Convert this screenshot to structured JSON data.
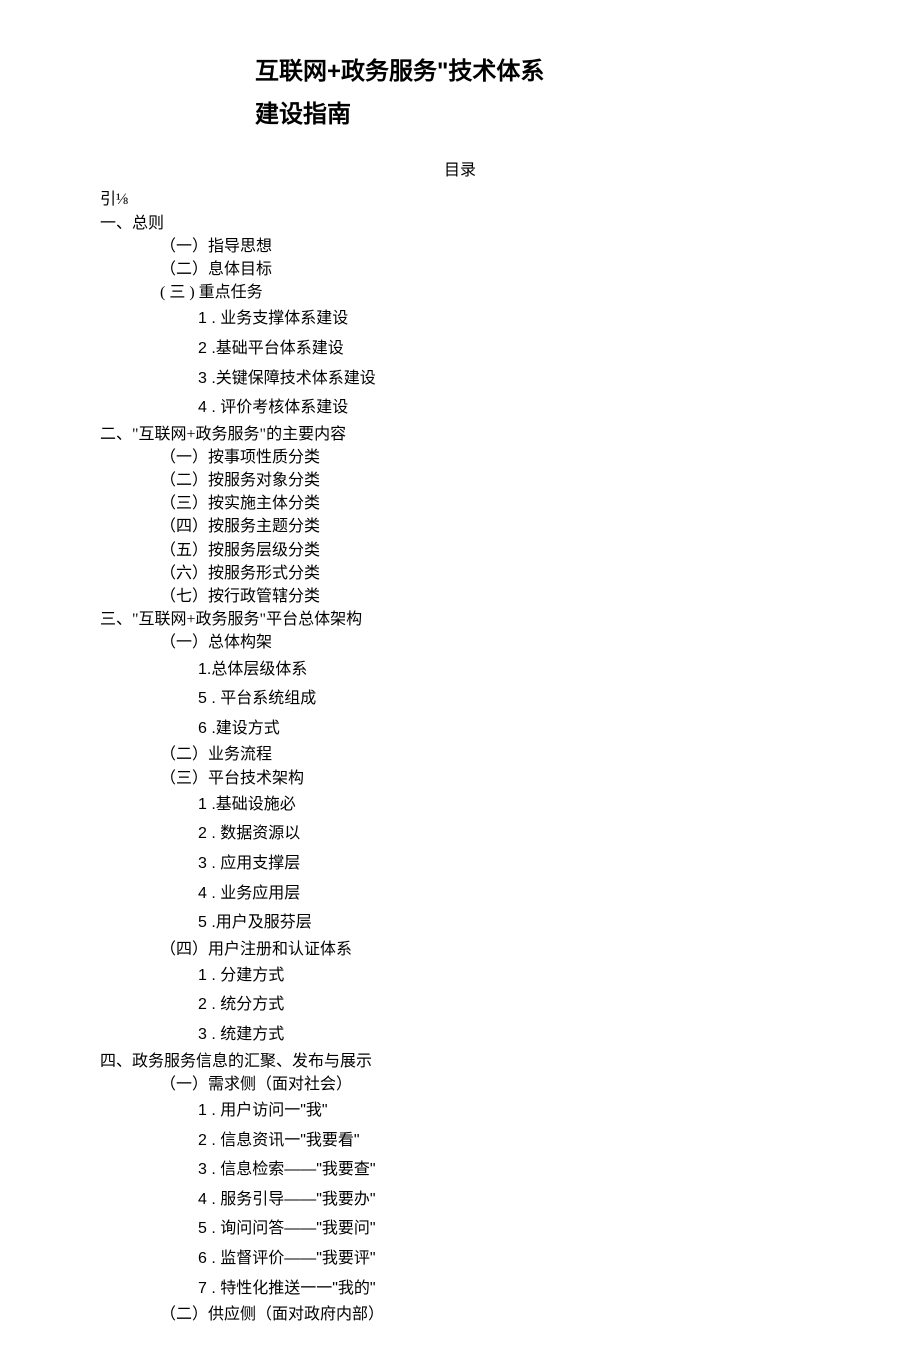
{
  "title": {
    "line1": "互联网+政务服务\"技术体系",
    "line2": "建设指南"
  },
  "toc_label": "目录",
  "toc": [
    {
      "lvl": 0,
      "text": "引⅛"
    },
    {
      "lvl": 1,
      "text": "一、总则"
    },
    {
      "lvl": 2,
      "text": "（一）指导思想"
    },
    {
      "lvl": 2,
      "text": "（二）息体目标"
    },
    {
      "lvl": 2,
      "text": "( 三 ) 重点任务"
    },
    {
      "lvl": 3,
      "num": "1",
      "text": " . 业务支撑体系建设"
    },
    {
      "lvl": 3,
      "num": "2",
      "text": " .基础平台体系建设"
    },
    {
      "lvl": 3,
      "num": "3",
      "text": " .关键保障技术体系建设"
    },
    {
      "lvl": 3,
      "num": "4",
      "text": " . 评价考核体系建设"
    },
    {
      "lvl": 1,
      "text": "二、\"互联网+政务服务\"的主要内容"
    },
    {
      "lvl": 2,
      "text": "（一）按事项性质分类"
    },
    {
      "lvl": 2,
      "text": "（二）按服务对象分类"
    },
    {
      "lvl": 2,
      "text": "（三）按实施主体分类"
    },
    {
      "lvl": 2,
      "text": "（四）按服务主题分类"
    },
    {
      "lvl": 2,
      "text": "（五）按服务层级分类"
    },
    {
      "lvl": 2,
      "text": "（六）按服务形式分类"
    },
    {
      "lvl": 2,
      "text": "（七）按行政管辖分类"
    },
    {
      "lvl": 1,
      "text": "三、\"互联网+政务服务\"平台总体架构"
    },
    {
      "lvl": 2,
      "text": "（一）总体构架"
    },
    {
      "lvl": 3,
      "num": "1.",
      "text": "总体层级体系"
    },
    {
      "lvl": 3,
      "num": "5",
      "text": " . 平台系统组成"
    },
    {
      "lvl": 3,
      "num": "6",
      "text": " .建设方式"
    },
    {
      "lvl": 2,
      "text": "（二）业务流程"
    },
    {
      "lvl": 2,
      "text": "（三）平台技术架构"
    },
    {
      "lvl": 3,
      "num": "1",
      "text": " .基础设施必"
    },
    {
      "lvl": 3,
      "num": "2",
      "text": " . 数据资源以"
    },
    {
      "lvl": 3,
      "num": "3",
      "text": " . 应用支撑层"
    },
    {
      "lvl": 3,
      "num": "4",
      "text": " . 业务应用层"
    },
    {
      "lvl": 3,
      "num": "5",
      "text": " .用户及服芬层"
    },
    {
      "lvl": 2,
      "text": "（四）用户注册和认证体系"
    },
    {
      "lvl": 3,
      "num": "1",
      "text": " . 分建方式"
    },
    {
      "lvl": 3,
      "num": "2",
      "text": " . 统分方式"
    },
    {
      "lvl": 3,
      "num": "3",
      "text": " . 统建方式"
    },
    {
      "lvl": 1,
      "text": "四、政务服务信息的汇聚、发布与展示"
    },
    {
      "lvl": 2,
      "text": "（一）需求侧（面对社会）"
    },
    {
      "lvl": 3,
      "num": "1",
      "text": " . 用户访问一\"我\""
    },
    {
      "lvl": 3,
      "num": "2",
      "text": " . 信息资讯一\"我要看\""
    },
    {
      "lvl": 3,
      "num": "3",
      "text": " . 信息检索——\"我要查\""
    },
    {
      "lvl": 3,
      "num": "4",
      "text": " . 服务引导——\"我要办\""
    },
    {
      "lvl": 3,
      "num": "5",
      "text": " . 询问问答——\"我要问\""
    },
    {
      "lvl": 3,
      "num": "6",
      "text": " . 监督评价——\"我要评\""
    },
    {
      "lvl": 3,
      "num": "7",
      "text": " . 特性化推送一一\"我的\""
    },
    {
      "lvl": 2,
      "text": "（二）供应侧（面对政府内部）"
    }
  ]
}
